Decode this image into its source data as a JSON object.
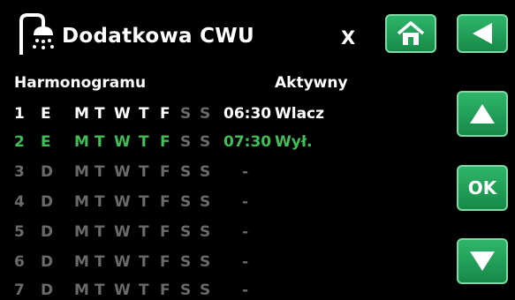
{
  "title_bar": {
    "icon": "shower-icon",
    "title": "Dodatkowa CWU",
    "close_label": "X"
  },
  "buttons": {
    "home_icon": "home-icon",
    "back_icon": "back-arrow-icon",
    "up_icon": "up-arrow-icon",
    "ok_label": "OK",
    "down_icon": "down-arrow-icon"
  },
  "columns": {
    "schedule": "Harmonogramu",
    "active": "Aktywny"
  },
  "rows": [
    {
      "num": "1",
      "mode": "E",
      "days": [
        "M",
        "T",
        "W",
        "T",
        "F",
        "S",
        "S"
      ],
      "time": "06:30",
      "status": "Wlacz",
      "state": "active"
    },
    {
      "num": "2",
      "mode": "E",
      "days": [
        "M",
        "T",
        "W",
        "T",
        "F",
        "S",
        "S"
      ],
      "time": "07:30",
      "status": "Wył.",
      "state": "selected"
    },
    {
      "num": "3",
      "mode": "D",
      "days": [
        "M",
        "T",
        "W",
        "T",
        "F",
        "S",
        "S"
      ],
      "time": "-",
      "status": "",
      "state": "disabled"
    },
    {
      "num": "4",
      "mode": "D",
      "days": [
        "M",
        "T",
        "W",
        "T",
        "F",
        "S",
        "S"
      ],
      "time": "-",
      "status": "",
      "state": "disabled"
    },
    {
      "num": "5",
      "mode": "D",
      "days": [
        "M",
        "T",
        "W",
        "T",
        "F",
        "S",
        "S"
      ],
      "time": "-",
      "status": "",
      "state": "disabled"
    },
    {
      "num": "6",
      "mode": "D",
      "days": [
        "M",
        "T",
        "W",
        "T",
        "F",
        "S",
        "S"
      ],
      "time": "-",
      "status": "",
      "state": "disabled"
    },
    {
      "num": "7",
      "mode": "D",
      "days": [
        "M",
        "T",
        "W",
        "T",
        "F",
        "S",
        "S"
      ],
      "time": "-",
      "status": "",
      "state": "disabled"
    }
  ],
  "colors": {
    "active": "#ffffff",
    "selected": "#3fbf55",
    "disabled": "#6a6a6a",
    "weekend_active": "#6a6a6a",
    "button": "#1f9e56"
  }
}
